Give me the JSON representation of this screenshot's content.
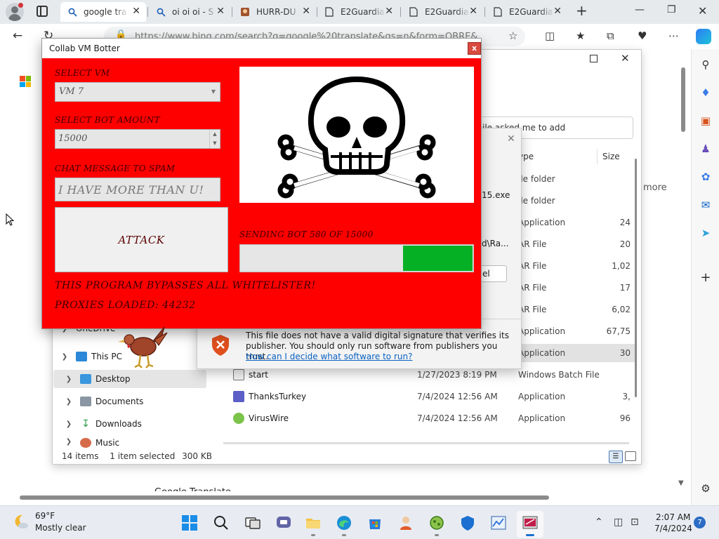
{
  "browser": {
    "tabs": [
      {
        "title": "google tra",
        "icon": "search-icon",
        "active": true
      },
      {
        "title": "oi oi oi - S",
        "icon": "search-icon",
        "active": false
      },
      {
        "title": "HURR-DU",
        "icon": "site-icon",
        "active": false
      },
      {
        "title": "E2Guardia",
        "icon": "page-icon",
        "active": false
      },
      {
        "title": "E2Guardia",
        "icon": "page-icon",
        "active": false
      },
      {
        "title": "E2Guardia",
        "icon": "page-icon",
        "active": false
      }
    ],
    "tab_close_glyph": "✕",
    "new_tab_glyph": "+",
    "address": "https://www.bing.com/search?q=google%20translate&qs=n&form=QBRE&",
    "page_more_link": "more",
    "bottom_label": "Google Translate",
    "accent": "#0a62c4"
  },
  "explorer": {
    "search_placeholder": "ile asked me to add",
    "columns": {
      "type": "ype",
      "size": "Size"
    },
    "partial_types": [
      {
        "type": "ile folder",
        "size": ""
      },
      {
        "type": "ile folder",
        "size": ""
      },
      {
        "type": "Application",
        "size": "24"
      },
      {
        "type": "AR File",
        "size": "20"
      },
      {
        "type": "AR File",
        "size": "1,02"
      },
      {
        "type": "AR File",
        "size": "17"
      },
      {
        "type": "AR File",
        "size": "6,02"
      },
      {
        "type": "Application",
        "size": "67,75"
      },
      {
        "type": "Application",
        "size": "30"
      }
    ],
    "files": [
      {
        "name": "start",
        "date": "1/27/2023 8:19 PM",
        "type": "Windows Batch File",
        "size": ""
      },
      {
        "name": "ThanksTurkey",
        "date": "7/4/2024 12:56 AM",
        "type": "Application",
        "size": "3,"
      },
      {
        "name": "VirusWire",
        "date": "7/4/2024 12:56 AM",
        "type": "Application",
        "size": "96"
      }
    ],
    "nav": [
      {
        "label": "OneDrive",
        "expanded": false
      },
      {
        "label": "This PC",
        "expanded": true
      },
      {
        "label": "Desktop",
        "expanded": false,
        "selected": true
      },
      {
        "label": "Documents",
        "expanded": false
      },
      {
        "label": "Downloads",
        "expanded": false
      },
      {
        "label": "Music",
        "expanded": false
      }
    ],
    "status": {
      "items": "14 items",
      "selected": "1 item selected",
      "size": "300 KB"
    }
  },
  "security_dialog": {
    "file_fragment": "15.exe",
    "path_fragment": "d\\Ra...",
    "button_fragment": "el",
    "message": "This file does not have a valid digital signature that verifies its publisher.  You should only run software from publishers you trust.",
    "link": "How can I decide what software to run?"
  },
  "vm_botter": {
    "title": "Collab VM Botter",
    "close_glyph": "x",
    "select_vm_label": "SELECT VM",
    "vm_value": "VM 7",
    "bot_amount_label": "SELECT BOT AMOUNT",
    "bot_amount": "15000",
    "chat_label": "CHAT MESSAGE TO SPAM",
    "chat_value": "I HAVE MORE THAN U!",
    "attack_label": "ATTACK",
    "progress_label": "SENDING BOT 580 OF 15000",
    "progress_fraction": 0.3,
    "bypass_text": "THIS PROGRAM BYPASSES ALL WHITELISTER!",
    "proxies_text": "PROXIES LOADED: 44232",
    "colors": {
      "background": "#ff0000",
      "progress": "#06b025"
    }
  },
  "taskbar": {
    "temperature": "69°F",
    "weather": "Mostly clear",
    "time": "2:07 AM",
    "date": "7/4/2024",
    "notifications": "7"
  }
}
